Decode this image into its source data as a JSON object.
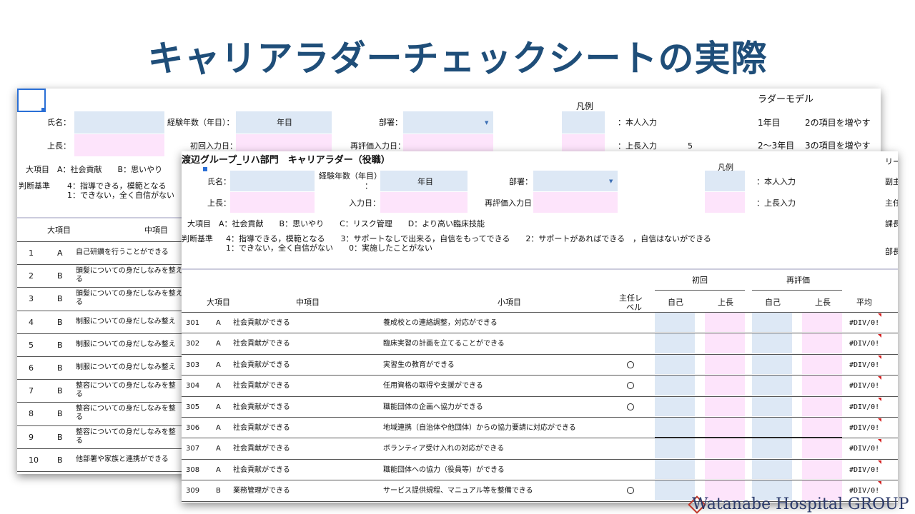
{
  "slide": {
    "title": "キャリアラダーチェックシートの実際",
    "logo_text": "Watanabe Hospital GROUP"
  },
  "sheet1": {
    "header": {
      "name_label": "氏名：",
      "years_label": "経験年数（年目）：",
      "years_value": "年目",
      "dept_label": "部署：",
      "boss_label": "上長：",
      "first_input_label": "初回入力日：",
      "reeval_label": "再評価入力日："
    },
    "legend": {
      "title": "凡例",
      "self_label": "：本人入力",
      "boss_label": "：上長入力",
      "boss_value": "5"
    },
    "ladder": {
      "title": "ラダーモデル",
      "rows": [
        {
          "year": "1年目",
          "desc": "2の項目を増やす"
        },
        {
          "year": "2〜3年目",
          "desc": "3の項目を増やす"
        }
      ]
    },
    "major_items": "大項目　A：社会貢献　　B：思いやり",
    "criteria_label": "判断基準",
    "criteria_line1": "4：指導できる，模範となる",
    "criteria_line2": "1：できない，全く自信がない",
    "columns": {
      "major": "大項目",
      "middle": "中項目"
    },
    "rows": [
      {
        "no": "1",
        "cat": "A",
        "text": "自己研鑽を行うことができる"
      },
      {
        "no": "2",
        "cat": "B",
        "text": "頭髪についての身だしなみを整え",
        "text2": "る"
      },
      {
        "no": "3",
        "cat": "B",
        "text": "頭髪についての身だしなみを整え",
        "text2": "る"
      },
      {
        "no": "4",
        "cat": "B",
        "text": "制服についての身だしなみ整え"
      },
      {
        "no": "5",
        "cat": "B",
        "text": "制服についての身だしなみ整え"
      },
      {
        "no": "6",
        "cat": "B",
        "text": "制服についての身だしなみ整え"
      },
      {
        "no": "7",
        "cat": "B",
        "text": "整容についての身だしなみを整",
        "text2": "る"
      },
      {
        "no": "8",
        "cat": "B",
        "text": "整容についての身だしなみを整",
        "text2": "る"
      },
      {
        "no": "9",
        "cat": "B",
        "text": "整容についての身だしなみを整",
        "text2": "る"
      },
      {
        "no": "10",
        "cat": "B",
        "text": "他部署や家族と連携ができる"
      }
    ]
  },
  "sheet2": {
    "title": "渡辺グループ_リハ部門　キャリアラダー（役職）",
    "header": {
      "name_label": "氏名：",
      "years_label": "経験年数（年目）",
      "years_colon": "：",
      "years_value": "年目",
      "dept_label": "部署：",
      "boss_label": "上長：",
      "input_label": "入力日：",
      "reeval_label": "再評価入力日："
    },
    "legend": {
      "title": "凡例",
      "self_label": "：本人入力",
      "boss_label": "：上長入力"
    },
    "right_labels": [
      "リー",
      "副主",
      "主任",
      "課長",
      "部長"
    ],
    "major_items": "大項目　A：社会貢献　　B：思いやり　　C：リスク管理　　D：より高い臨床技能",
    "criteria_label": "判断基準",
    "criteria_line1": "4：指導できる，模範となる　　3：サポートなしで出来る，自信をもってできる　　2：サポートがあればできる　，自信はないができる",
    "criteria_line2": "1：できない，全く自信がない　　0：実施したことがない",
    "columns": {
      "major": "大項目",
      "middle": "中項目",
      "minor": "小項目",
      "level1": "主任レ",
      "level2": "ベル",
      "first": "初回",
      "reeval": "再評価",
      "self": "自己",
      "boss": "上長",
      "avg": "平均"
    },
    "rows": [
      {
        "no": "301",
        "cat": "A",
        "mid": "社会貢献ができる",
        "minor": "養成校との連絡調整，対応ができる",
        "mark": "",
        "avg": "#DIV/0!"
      },
      {
        "no": "302",
        "cat": "A",
        "mid": "社会貢献ができる",
        "minor": "臨床実習の計画を立てることができる",
        "mark": "",
        "avg": "#DIV/0!"
      },
      {
        "no": "303",
        "cat": "A",
        "mid": "社会貢献ができる",
        "minor": "実習生の教育ができる",
        "mark": "o",
        "avg": "#DIV/0!"
      },
      {
        "no": "304",
        "cat": "A",
        "mid": "社会貢献ができる",
        "minor": "任用資格の取得や支援ができる",
        "mark": "o",
        "avg": "#DIV/0!"
      },
      {
        "no": "305",
        "cat": "A",
        "mid": "社会貢献ができる",
        "minor": "職能団体の企画へ協力ができる",
        "mark": "o",
        "avg": "#DIV/0!"
      },
      {
        "no": "306",
        "cat": "A",
        "mid": "社会貢献ができる",
        "minor": "地域連携（自治体や他団体）からの協力要請に対応ができる",
        "mark": "",
        "avg": "#DIV/0!"
      },
      {
        "no": "307",
        "cat": "A",
        "mid": "社会貢献ができる",
        "minor": "ボランティア受け入れの対応ができる",
        "mark": "",
        "avg": "#DIV/0!"
      },
      {
        "no": "308",
        "cat": "A",
        "mid": "社会貢献ができる",
        "minor": "職能団体への協力（役員等）ができる",
        "mark": "",
        "avg": "#DIV/0!"
      },
      {
        "no": "309",
        "cat": "B",
        "mid": "業務管理ができる",
        "minor": "サービス提供規程、マニュアル等を整備できる",
        "mark": "o",
        "avg": "#DIV/0!"
      }
    ]
  }
}
